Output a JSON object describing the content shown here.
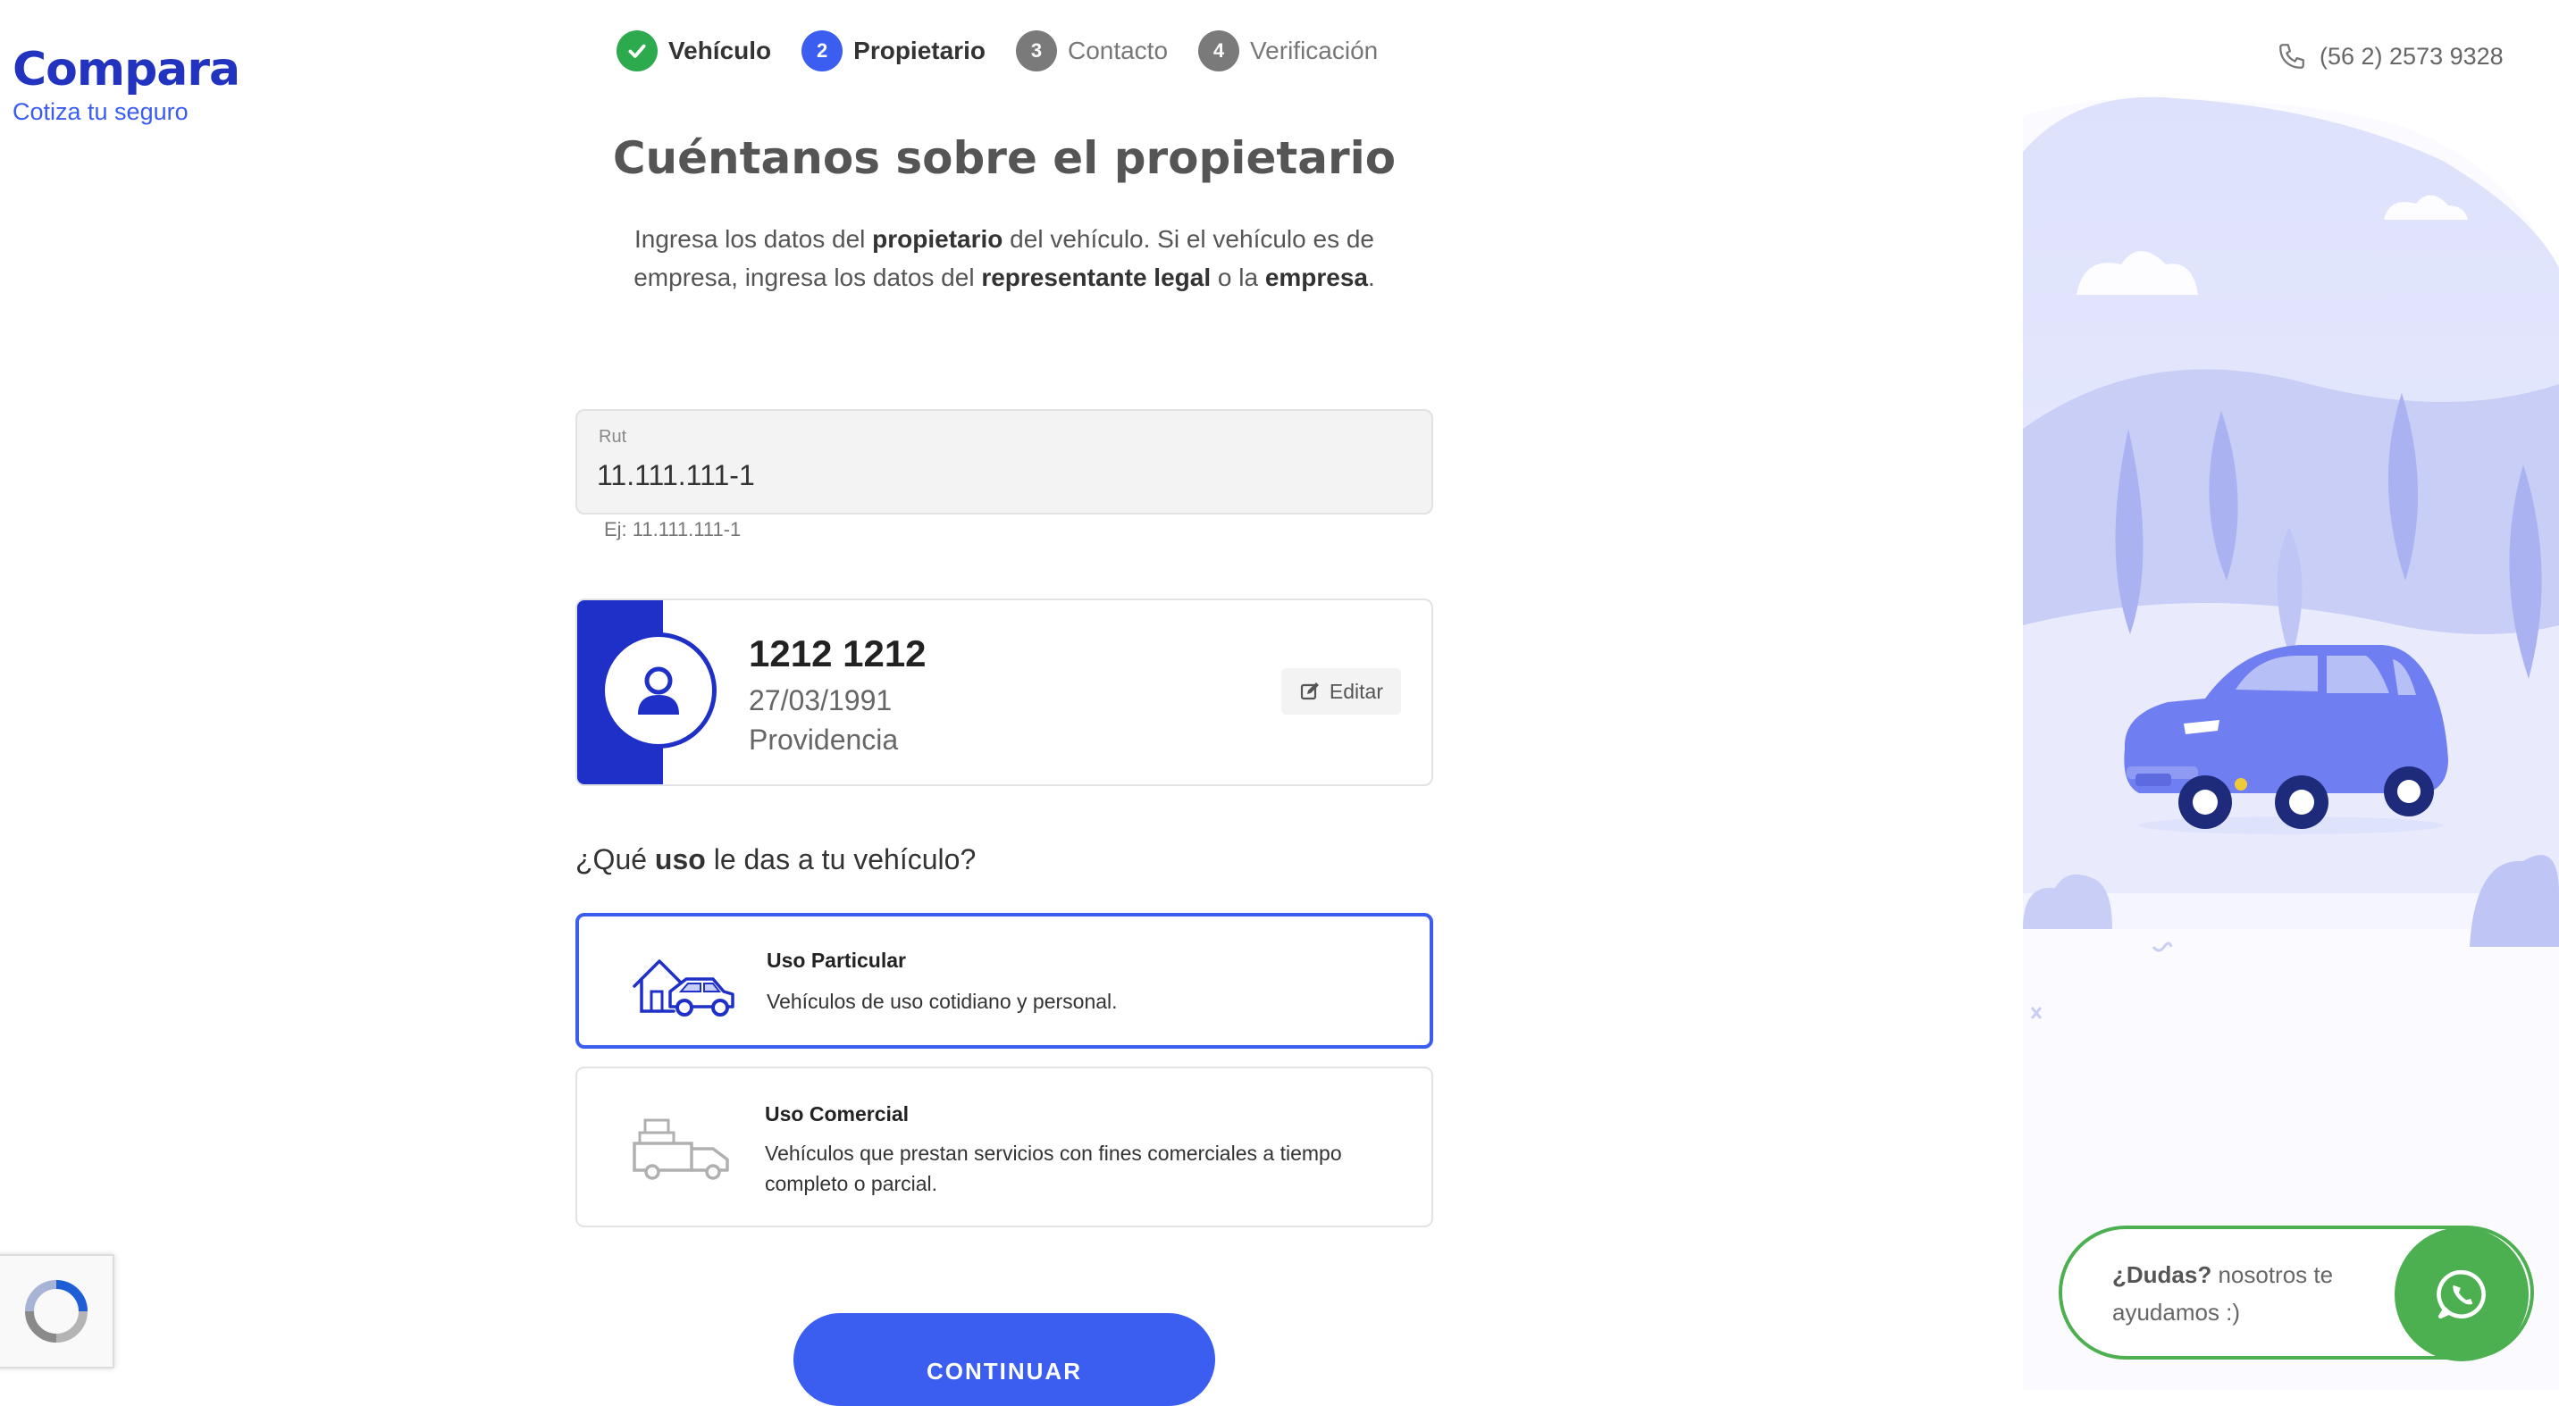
{
  "logo": {
    "name": "Compara",
    "tagline": "Cotiza tu seguro"
  },
  "stepper": [
    {
      "num": "1",
      "label": "Vehículo",
      "state": "done"
    },
    {
      "num": "2",
      "label": "Propietario",
      "state": "active"
    },
    {
      "num": "3",
      "label": "Contacto",
      "state": "pending"
    },
    {
      "num": "4",
      "label": "Verificación",
      "state": "pending"
    }
  ],
  "main": {
    "title": "Cuéntanos sobre el propietario",
    "desc": {
      "t1": "Ingresa los datos del ",
      "b1": "propietario",
      "t2": " del vehículo. Si el vehículo es de empresa, ingresa los datos del ",
      "b2": "representante legal",
      "t3": " o la ",
      "b3": "empresa",
      "t4": "."
    },
    "rut": {
      "label": "Rut",
      "value": "11.111.111-1",
      "hint": "Ej: 11.111.111-1"
    },
    "owner": {
      "name": "1212 1212",
      "birthdate": "27/03/1991",
      "commune": "Providencia",
      "edit_label": "Editar"
    },
    "usage": {
      "question": {
        "pre": "¿Qué ",
        "bold": "uso",
        "post": " le das a tu vehículo?"
      },
      "options": [
        {
          "title": "Uso Particular",
          "desc": "Vehículos de uso cotidiano y personal.",
          "selected": true
        },
        {
          "title": "Uso Comercial",
          "desc": "Vehículos que prestan servicios con fines comerciales a tiempo completo o parcial.",
          "selected": false
        }
      ]
    },
    "continue_label": "CONTINUAR"
  },
  "sidebar": {
    "phone": "(56 2) 2573 9328",
    "chat": {
      "bold": "¿Dudas?",
      "text": " nosotros te ayudamos :)"
    }
  },
  "colors": {
    "brand": "#2233c0",
    "accent": "#3b5ef0",
    "success": "#2eaa4e",
    "whatsapp": "#4caf50",
    "illustration": "#6f7ef0"
  },
  "icons": [
    "check-icon",
    "user-icon",
    "edit-icon",
    "house-car-icon",
    "truck-icon",
    "phone-icon",
    "whatsapp-icon",
    "recaptcha-icon"
  ]
}
